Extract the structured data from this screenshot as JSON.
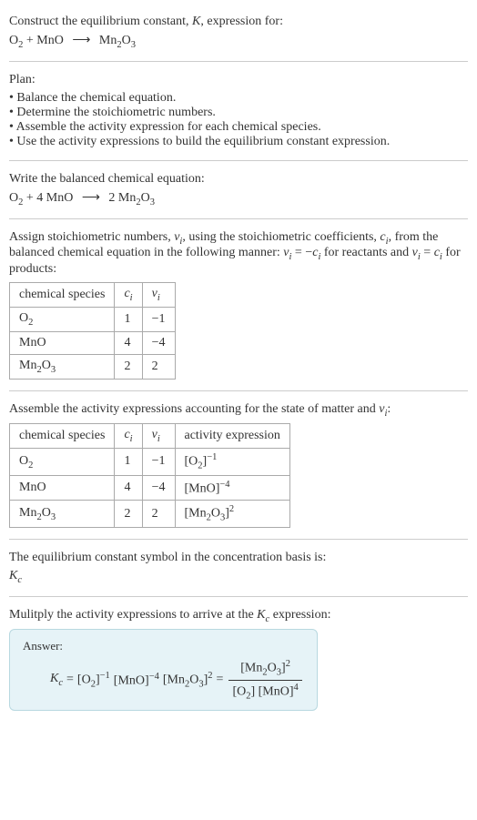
{
  "heading": "Construct the equilibrium constant, K, expression for:",
  "reaction_unbalanced_lhs1": "O",
  "reaction_unbalanced_lhs1_sub": "2",
  "reaction_unbalanced_plus": " + MnO ",
  "reaction_unbalanced_rhs": " Mn",
  "reaction_unbalanced_rhs_sub1": "2",
  "reaction_unbalanced_rhs_o": "O",
  "reaction_unbalanced_rhs_sub2": "3",
  "plan_label": "Plan:",
  "plan_items": [
    "Balance the chemical equation.",
    "Determine the stoichiometric numbers.",
    "Assemble the activity expression for each chemical species.",
    "Use the activity expressions to build the equilibrium constant expression."
  ],
  "balanced_label": "Write the balanced chemical equation:",
  "balanced_lhs_o": "O",
  "balanced_lhs_o_sub": "2",
  "balanced_lhs_plus": " + 4 MnO ",
  "balanced_rhs_prefix": " 2 Mn",
  "balanced_rhs_sub1": "2",
  "balanced_rhs_o2": "O",
  "balanced_rhs_sub2": "3",
  "assign_text_a": "Assign stoichiometric numbers, ",
  "assign_nu": "ν",
  "assign_nu_sub": "i",
  "assign_text_b": ", using the stoichiometric coefficients, ",
  "assign_c": "c",
  "assign_c_sub": "i",
  "assign_text_c": ", from the balanced chemical equation in the following manner: ",
  "assign_text_d": " = −",
  "assign_text_e": " for reactants and ",
  "assign_text_f": " = ",
  "assign_text_g": " for products:",
  "table1": {
    "h1": "chemical species",
    "h2_c": "c",
    "h2_sub": "i",
    "h3_v": "ν",
    "h3_sub": "i",
    "rows": [
      {
        "species_a": "O",
        "species_sub": "2",
        "species_b": "",
        "species_sub2": "",
        "c": "1",
        "v": "−1"
      },
      {
        "species_a": "MnO",
        "species_sub": "",
        "species_b": "",
        "species_sub2": "",
        "c": "4",
        "v": "−4"
      },
      {
        "species_a": "Mn",
        "species_sub": "2",
        "species_b": "O",
        "species_sub2": "3",
        "c": "2",
        "v": "2"
      }
    ]
  },
  "assemble_text_a": "Assemble the activity expressions accounting for the state of matter and ",
  "assemble_text_b": ":",
  "table2": {
    "h1": "chemical species",
    "h2_c": "c",
    "h2_sub": "i",
    "h3_v": "ν",
    "h3_sub": "i",
    "h4": "activity expression",
    "rows": [
      {
        "sp_a": "O",
        "sp_sub": "2",
        "sp_b": "",
        "sp_sub2": "",
        "c": "1",
        "v": "−1",
        "ae_a": "[O",
        "ae_sub": "2",
        "ae_b": "]",
        "ae_sup": "−1",
        "ae_c": "",
        "ae_sub2": "",
        "ae_d": ""
      },
      {
        "sp_a": "MnO",
        "sp_sub": "",
        "sp_b": "",
        "sp_sub2": "",
        "c": "4",
        "v": "−4",
        "ae_a": "[MnO]",
        "ae_sub": "",
        "ae_b": "",
        "ae_sup": "−4",
        "ae_c": "",
        "ae_sub2": "",
        "ae_d": ""
      },
      {
        "sp_a": "Mn",
        "sp_sub": "2",
        "sp_b": "O",
        "sp_sub2": "3",
        "c": "2",
        "v": "2",
        "ae_a": "[Mn",
        "ae_sub": "2",
        "ae_b": "O",
        "ae_sup": "",
        "ae_c": "",
        "ae_sub2": "3",
        "ae_d": "]",
        "ae_sup2": "2"
      }
    ]
  },
  "eqconst_text": "The equilibrium constant symbol in the concentration basis is:",
  "eqconst_k": "K",
  "eqconst_sub": "c",
  "multiply_text_a": "Mulitply the activity expressions to arrive at the ",
  "multiply_text_b": " expression:",
  "answer_label": "Answer:",
  "kc_eq": " = ",
  "kc_o2_a": "[O",
  "kc_o2_sub": "2",
  "kc_o2_b": "]",
  "kc_o2_sup": "−1",
  "kc_mno_a": " [MnO]",
  "kc_mno_sup": "−4",
  "kc_mn2o3_a": " [Mn",
  "kc_mn2o3_sub1": "2",
  "kc_mn2o3_b": "O",
  "kc_mn2o3_sub2": "3",
  "kc_mn2o3_c": "]",
  "kc_mn2o3_sup": "2",
  "frac_num_a": "[Mn",
  "frac_num_sub1": "2",
  "frac_num_b": "O",
  "frac_num_sub2": "3",
  "frac_num_c": "]",
  "frac_num_sup": "2",
  "frac_den_a": "[O",
  "frac_den_sub": "2",
  "frac_den_b": "] [MnO]",
  "frac_den_sup": "4"
}
